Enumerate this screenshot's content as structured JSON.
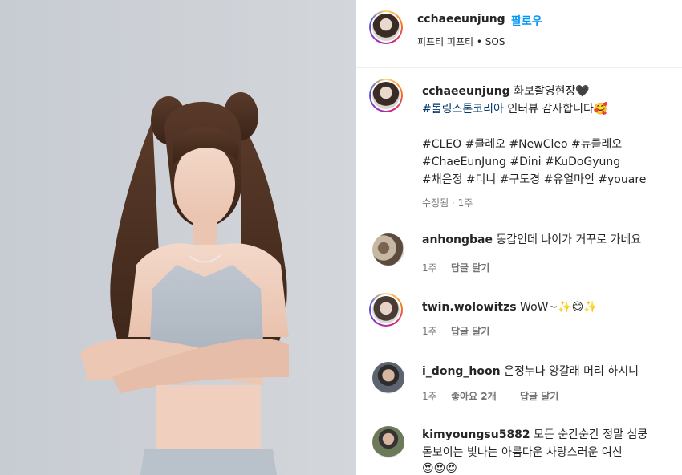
{
  "post": {
    "username": "cchaeeunjung",
    "dot": "•",
    "follow_label": "팔로우",
    "audio_label": "피프티 피프티 • SOS"
  },
  "caption": {
    "username": "cchaeeunjung",
    "line1_text": "화보촬영현장🖤",
    "line2_tag": "#롤링스톤코리아",
    "line2_text": " 인터뷰 감사합니다🥰",
    "tags_line1": "#CLEO #클레오 #NewCleo #뉴클레오",
    "tags_line2": "#ChaeEunJung #Dini #KuDoGyung",
    "tags_line3": "#채은정 #디니 #구도경 #유얼마인 #youare",
    "meta": "수정됨 · 1주"
  },
  "comments": [
    {
      "username": "anhongbae",
      "text": "동갑인데 나이가 거꾸로 가네요",
      "time": "1주",
      "likes": "",
      "reply": "답글 달기"
    },
    {
      "username": "twin.wolowitzs",
      "text": "WoW~✨😄✨",
      "time": "1주",
      "likes": "",
      "reply": "답글 달기"
    },
    {
      "username": "i_dong_hoon",
      "text": "은정누나 양갈래 머리 하시니",
      "time": "1주",
      "likes": "좋아요 2개",
      "reply": "답글 달기"
    },
    {
      "username": "kimyoungsu5882",
      "text": "모든 순간순간 정말 심쿵",
      "text2": "돋보이는 빛나는 아름다운 사랑스러운 여신",
      "text3": "😍😍😍",
      "time": "",
      "likes": "",
      "reply": ""
    }
  ],
  "icons": {
    "post_avatar": "profile-avatar-icon",
    "caption_avatar": "profile-avatar-icon"
  }
}
